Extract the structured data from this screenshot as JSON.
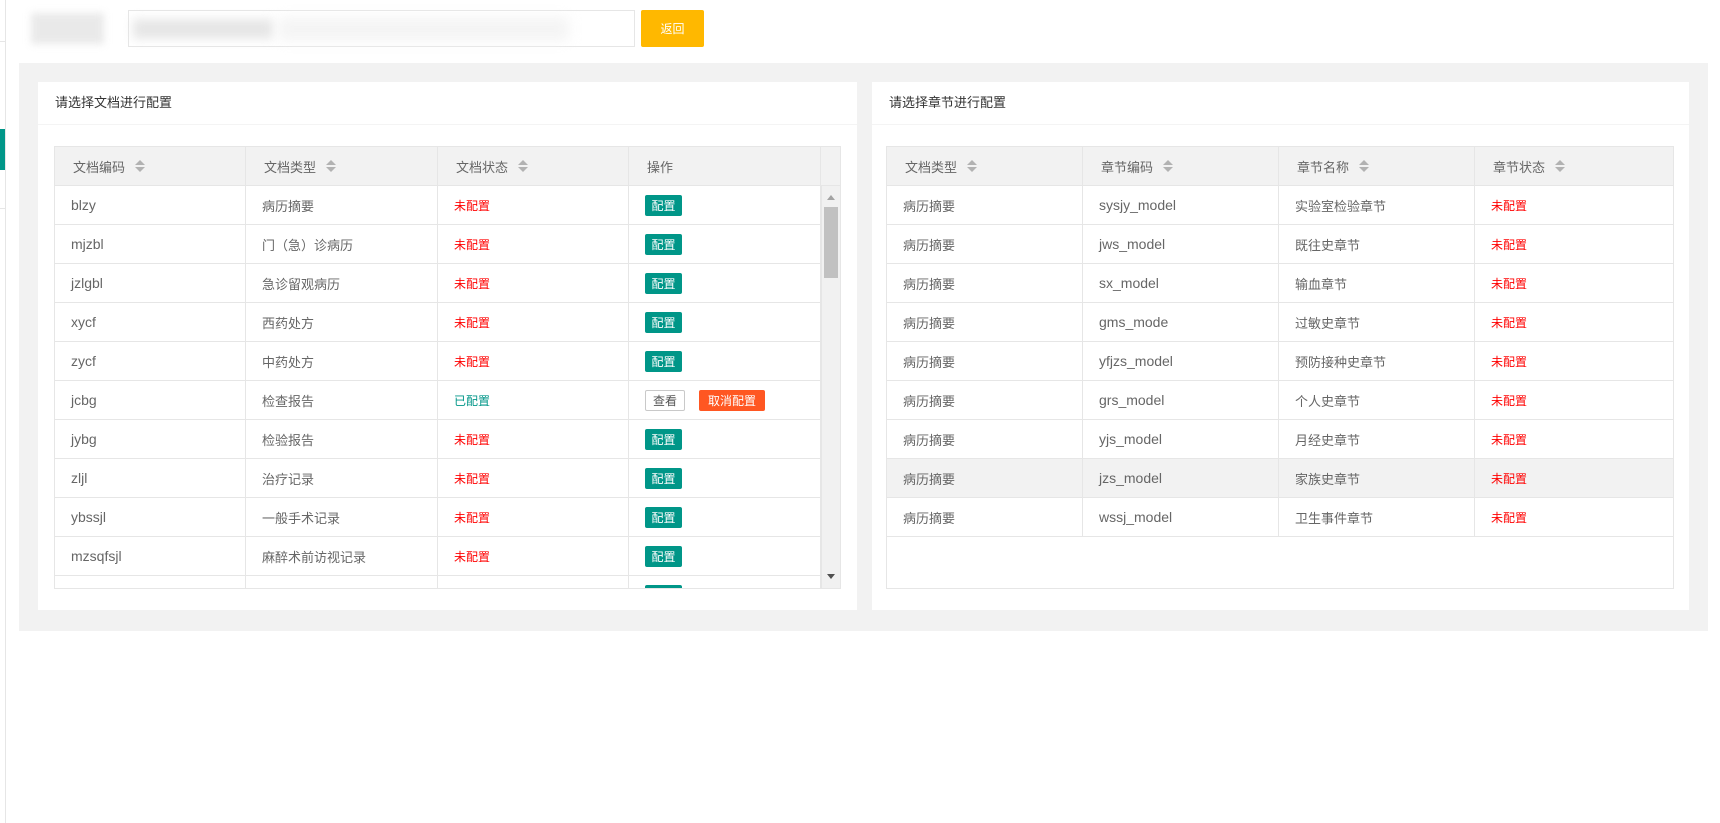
{
  "topbar": {
    "back_button": "返回"
  },
  "colors": {
    "primary": "#009688",
    "warm": "#FFB800",
    "danger": "#FF5722",
    "status_unconfigured": "#FF0000",
    "status_configured": "#009688",
    "panel_background": "#F2F2F2"
  },
  "icons": {
    "sort": "sort-icon",
    "scroll_up": "scroll-up-icon",
    "scroll_down": "scroll-down-icon"
  },
  "document_panel": {
    "title": "请选择文档进行配置",
    "columns": {
      "code": "文档编码",
      "type": "文档类型",
      "status": "文档状态",
      "action": "操作"
    },
    "actions": {
      "configure": "配置",
      "view": "查看",
      "unconfigure": "取消配置"
    },
    "rows": [
      {
        "code": "blzy",
        "type": "病历摘要",
        "status": "未配置"
      },
      {
        "code": "mjzbl",
        "type": "门（急）诊病历",
        "status": "未配置"
      },
      {
        "code": "jzlgbl",
        "type": "急诊留观病历",
        "status": "未配置"
      },
      {
        "code": "xycf",
        "type": "西药处方",
        "status": "未配置"
      },
      {
        "code": "zycf",
        "type": "中药处方",
        "status": "未配置"
      },
      {
        "code": "jcbg",
        "type": "检查报告",
        "status": "已配置"
      },
      {
        "code": "jybg",
        "type": "检验报告",
        "status": "未配置"
      },
      {
        "code": "zljl",
        "type": "治疗记录",
        "status": "未配置"
      },
      {
        "code": "ybssjl",
        "type": "一般手术记录",
        "status": "未配置"
      },
      {
        "code": "mzsqfsjl",
        "type": "麻醉术前访视记录",
        "status": "未配置"
      }
    ]
  },
  "chapter_panel": {
    "title": "请选择章节进行配置",
    "columns": {
      "doc_type": "文档类型",
      "code": "章节编码",
      "name": "章节名称",
      "status": "章节状态"
    },
    "rows": [
      {
        "doc_type": "病历摘要",
        "code": "sysjy_model",
        "name": "实验室检验章节",
        "status": "未配置"
      },
      {
        "doc_type": "病历摘要",
        "code": "jws_model",
        "name": "既往史章节",
        "status": "未配置"
      },
      {
        "doc_type": "病历摘要",
        "code": "sx_model",
        "name": "输血章节",
        "status": "未配置"
      },
      {
        "doc_type": "病历摘要",
        "code": "gms_mode",
        "name": "过敏史章节",
        "status": "未配置"
      },
      {
        "doc_type": "病历摘要",
        "code": "yfjzs_model",
        "name": "预防接种史章节",
        "status": "未配置"
      },
      {
        "doc_type": "病历摘要",
        "code": "grs_model",
        "name": "个人史章节",
        "status": "未配置"
      },
      {
        "doc_type": "病历摘要",
        "code": "yjs_model",
        "name": "月经史章节",
        "status": "未配置"
      },
      {
        "doc_type": "病历摘要",
        "code": "jzs_model",
        "name": "家族史章节",
        "status": "未配置"
      },
      {
        "doc_type": "病历摘要",
        "code": "wssj_model",
        "name": "卫生事件章节",
        "status": "未配置"
      }
    ]
  }
}
